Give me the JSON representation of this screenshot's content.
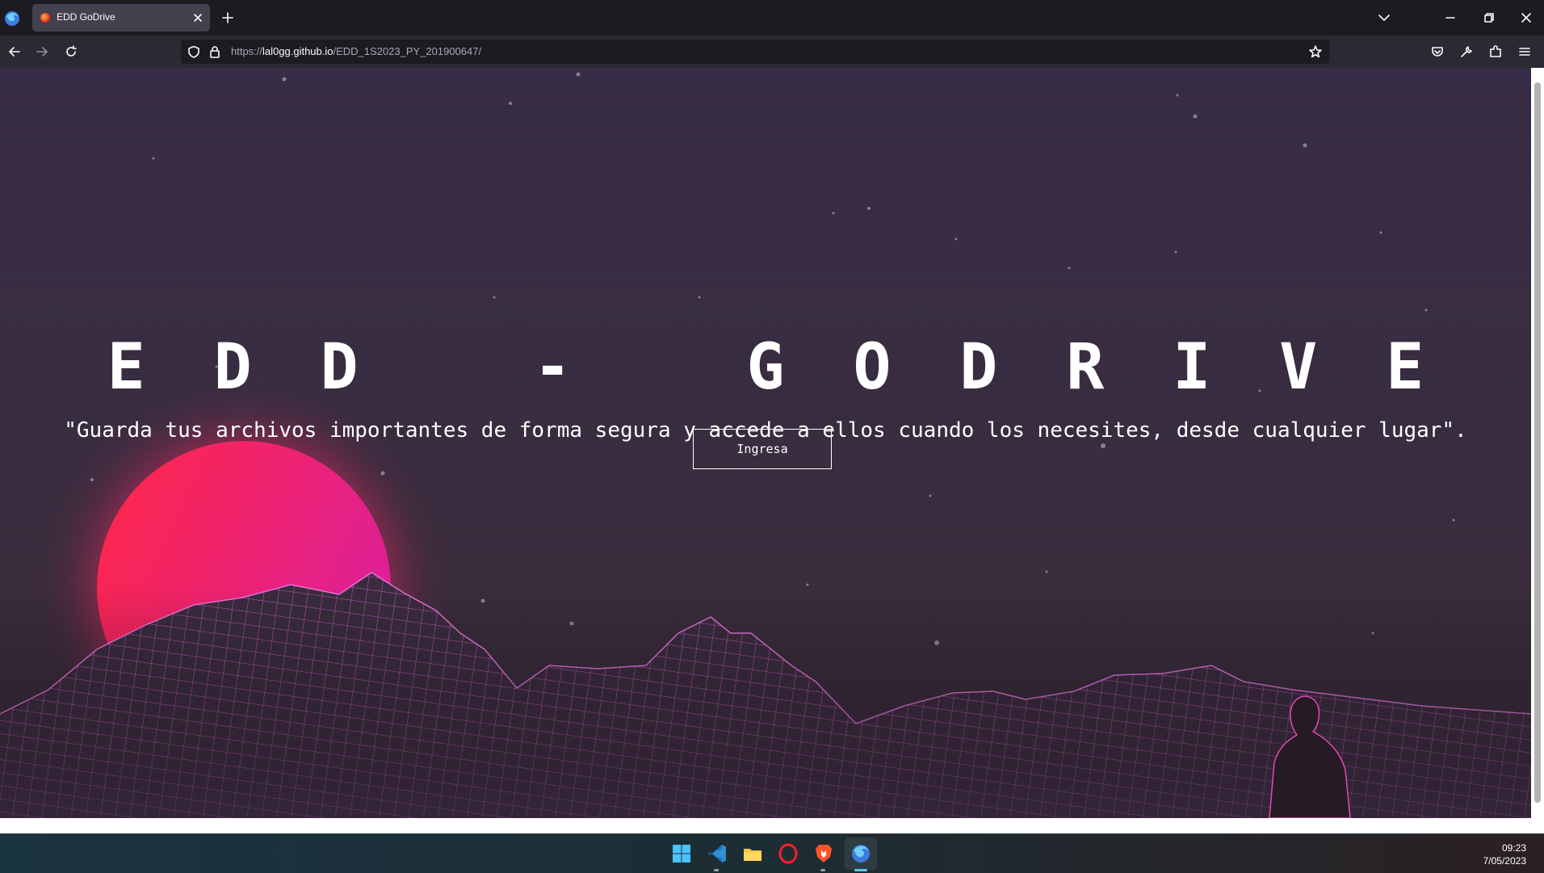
{
  "browser": {
    "tab_title": "EDD GoDrive",
    "url": {
      "scheme": "https://",
      "host": "lal0gg.github.io",
      "path": "/EDD_1S2023_PY_201900647/"
    },
    "icons": {
      "app": "firefox-icon",
      "tab_close": "close-icon",
      "new_tab": "plus-icon",
      "tab_list": "chevron-down-icon",
      "back": "arrow-left-icon",
      "forward": "arrow-right-icon",
      "reload": "reload-icon",
      "tracking_protection": "shield-icon",
      "secure": "lock-icon",
      "bookmark": "star-icon",
      "pocket": "pocket-icon",
      "devtools": "wrench-icon",
      "extensions": "puzzle-icon",
      "menu": "hamburger-menu-icon",
      "minimize": "minimize-icon",
      "restore": "restore-icon",
      "close_window": "close-icon"
    }
  },
  "page": {
    "title": "EDD - GODRIVE",
    "subtitle": "\"Guarda tus archivos importantes de forma segura y accede a ellos cuando los necesites, desde cualquier lugar\".",
    "cta_label": "Ingresa",
    "colors": {
      "background": "#382d40",
      "sun_start": "#ff2746",
      "sun_end": "#d61fa8",
      "wireframe": "#e05ad0",
      "text": "#ffffff"
    }
  },
  "taskbar": {
    "apps": [
      {
        "name": "start-menu",
        "icon": "windows-logo-icon"
      },
      {
        "name": "vscode",
        "icon": "vscode-icon"
      },
      {
        "name": "file-explorer",
        "icon": "folder-icon"
      },
      {
        "name": "opera",
        "icon": "opera-icon"
      },
      {
        "name": "brave",
        "icon": "brave-icon"
      },
      {
        "name": "firefox",
        "icon": "firefox-icon"
      }
    ],
    "time": "09:23",
    "date": "7/05/2023"
  }
}
